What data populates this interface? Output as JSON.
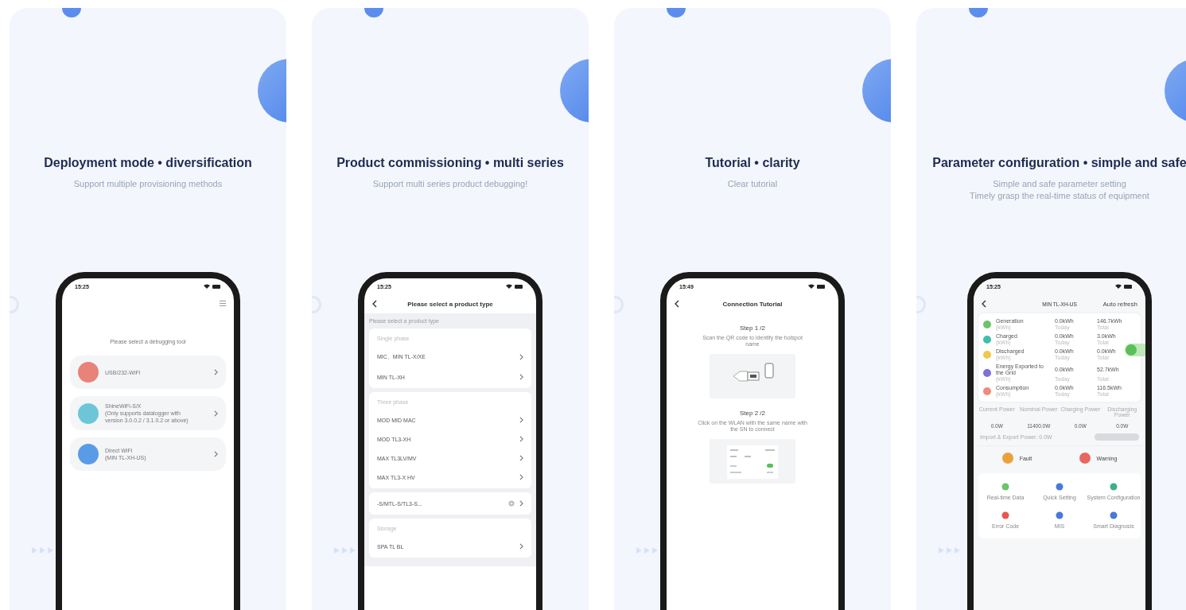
{
  "panels": [
    {
      "title": "Deployment mode • diversification",
      "subtitle": [
        "Support multiple provisioning methods"
      ],
      "phone": {
        "kind": "tools",
        "time": "15:25",
        "prompt": "Please select a debugging tool",
        "tools": [
          {
            "lines": [
              "USB/232-WiFi"
            ],
            "color": "#e8837a"
          },
          {
            "lines": [
              "ShineWiFi-S/X",
              "(Only supports datalogger with",
              "version 3.0.0.2 / 3.1.0.2 or above)"
            ],
            "color": "#6cc6d8"
          },
          {
            "lines": [
              "Direct WiFi",
              "(MIN TL-XH-US)"
            ],
            "color": "#5a9be8"
          }
        ]
      }
    },
    {
      "title": "Product commissioning • multi series",
      "subtitle": [
        "Support multi series product debugging!"
      ],
      "phone": {
        "kind": "products",
        "time": "15:25",
        "title": "Please select a product type",
        "hint": "Please select a product type",
        "groups": [
          {
            "heading": "Single phase",
            "items": [
              {
                "label": "MIC、MIN TL-X/XE",
                "kind": "plain"
              },
              {
                "label": "MIN TL-XH",
                "kind": "plain"
              }
            ]
          },
          {
            "heading": "Three phase",
            "items": [
              {
                "label": "MOD MID MAC",
                "kind": "plain"
              },
              {
                "label": "MOD TL3-XH",
                "kind": "plain"
              },
              {
                "label": "MAX TL3LV/MV",
                "kind": "plain"
              },
              {
                "label": "MAX TL3-X HV",
                "kind": "plain"
              }
            ]
          },
          {
            "items": [
              {
                "label": "-S/MTL-S/TL3-S...",
                "kind": "info"
              }
            ]
          },
          {
            "heading": "Storage",
            "items": [
              {
                "label": "SPA TL BL",
                "kind": "plain"
              }
            ]
          }
        ]
      }
    },
    {
      "title": "Tutorial • clarity",
      "subtitle": [
        "Clear tutorial"
      ],
      "phone": {
        "kind": "tutorial",
        "time": "15:49",
        "title": "Connection Tutorial",
        "steps": [
          {
            "title": "Step 1 /2",
            "text": "Scan the QR code to identify the hotspot name",
            "kind": "scan"
          },
          {
            "title": "Step 2 /2",
            "text": "Click on the WLAN with the same name with the SN to connect",
            "kind": "wlan"
          }
        ]
      }
    },
    {
      "title": "Parameter configuration • simple and safe",
      "subtitle": [
        "Simple and safe parameter setting",
        "Timely grasp the real-time status of equipment"
      ],
      "phone": {
        "kind": "dashboard",
        "time": "15:25",
        "device": "MIN TL-XH-US",
        "refresh": "Auto refresh",
        "energy": [
          {
            "label": "Generation",
            "unit": "(kWh)",
            "today": "0.0kWh",
            "today_label": "Today",
            "total": "146.7kWh",
            "total_label": "Total",
            "color": "#6cc36a"
          },
          {
            "label": "Charged",
            "unit": "(kWh)",
            "today": "0.0kWh",
            "today_label": "Today",
            "total": "3.0kWh",
            "total_label": "Total",
            "color": "#3fbfa6"
          },
          {
            "label": "Discharged",
            "unit": "(kWh)",
            "today": "0.0kWh",
            "today_label": "Today",
            "total": "0.0kWh",
            "total_label": "Total",
            "color": "#f0c84a"
          },
          {
            "label": "Energy Exported to the Grid",
            "unit": "(kWh)",
            "today": "0.0kWh",
            "today_label": "Today",
            "total": "52.7kWh",
            "total_label": "Total",
            "color": "#7c6fe0"
          },
          {
            "label": "Consumption",
            "unit": "(kWh)",
            "today": "0.0kWh",
            "today_label": "Today",
            "total": "116.5kWh",
            "total_label": "Total",
            "color": "#f08a7a"
          }
        ],
        "power": [
          {
            "label": "Current Power",
            "value": "0.0W"
          },
          {
            "label": "Nominal Power",
            "value": "11400.0W"
          },
          {
            "label": "Charging Power",
            "value": "0.0W"
          },
          {
            "label": "Discharging Power",
            "value": "0.0W"
          }
        ],
        "import_export": "Import & Export Power: 0.0W",
        "alarms": [
          {
            "label": "Fault",
            "color": "#e9a23b"
          },
          {
            "label": "Warning",
            "color": "#e8675f"
          }
        ],
        "menu": [
          {
            "label": "Real-time Data",
            "color": "#6cc36a"
          },
          {
            "label": "Quick Setting",
            "color": "#4a78d8"
          },
          {
            "label": "System Configuration",
            "color": "#3fae8a"
          },
          {
            "label": "Error Code",
            "color": "#e5574f"
          },
          {
            "label": "MIS",
            "color": "#4a78d8"
          },
          {
            "label": "Smart Diagnosis",
            "color": "#4a78d8"
          }
        ]
      }
    }
  ]
}
